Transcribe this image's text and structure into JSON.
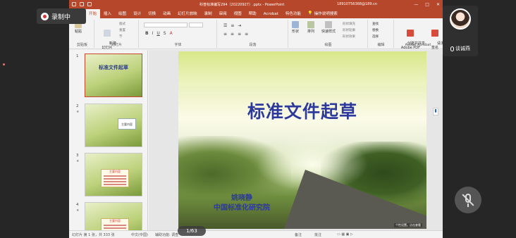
{
  "titlebar": {
    "document": "科普标准编写294（20220927）.pptx - PowerPoint",
    "account": "18910756368@189.cn",
    "min": "—",
    "max": "□",
    "close": "✕"
  },
  "tabs": [
    "文件",
    "开始",
    "插入",
    "绘图",
    "设计",
    "切换",
    "动画",
    "幻灯片放映",
    "录制",
    "审阅",
    "视图",
    "帮助",
    "Acrobat",
    "特色功能"
  ],
  "tell_me": "操作说明搜索",
  "ribbon": {
    "paste": "粘贴",
    "new_slide": "新建\n幻灯片",
    "layout": "版式",
    "reset": "重置",
    "section": "节",
    "clipboard": "剪贴板",
    "slides": "幻灯片",
    "font": "字体",
    "paragraph": "段落",
    "drawing": "绘图",
    "shape": "形状",
    "arrange": "排列",
    "quick_styles": "快速样式",
    "shape_fill": "形状填充",
    "shape_outline": "形状轮廓",
    "shape_effects": "形状效果",
    "find": "查找",
    "replace": "替换",
    "select": "选择",
    "editing": "编辑",
    "create_share": "创建并共享\nAdobe PDF",
    "request_sign": "请求\n签名",
    "adobe": "Adobe Acrobat"
  },
  "thumbnails": [
    {
      "num": "1",
      "title": "标准文件起草"
    },
    {
      "num": "2",
      "box": "主要内容"
    },
    {
      "num": "3",
      "box": "主要内容"
    },
    {
      "num": "4",
      "box": "主要内容"
    }
  ],
  "slide": {
    "title": "标准文件起草",
    "author": "姚晓静",
    "org": "中国标准化研究院",
    "watermark": "个性设置。点击查看"
  },
  "status": {
    "slide_info": "幻灯片 第 1 张，共 333 张",
    "language": "中文(中国)",
    "accessibility": "辅助功能: 调查",
    "notes": "备注",
    "comments": "批注"
  },
  "page_indicator": "1/63",
  "recording": {
    "label": "录制中"
  },
  "participant": {
    "name": "谈诚燕"
  }
}
